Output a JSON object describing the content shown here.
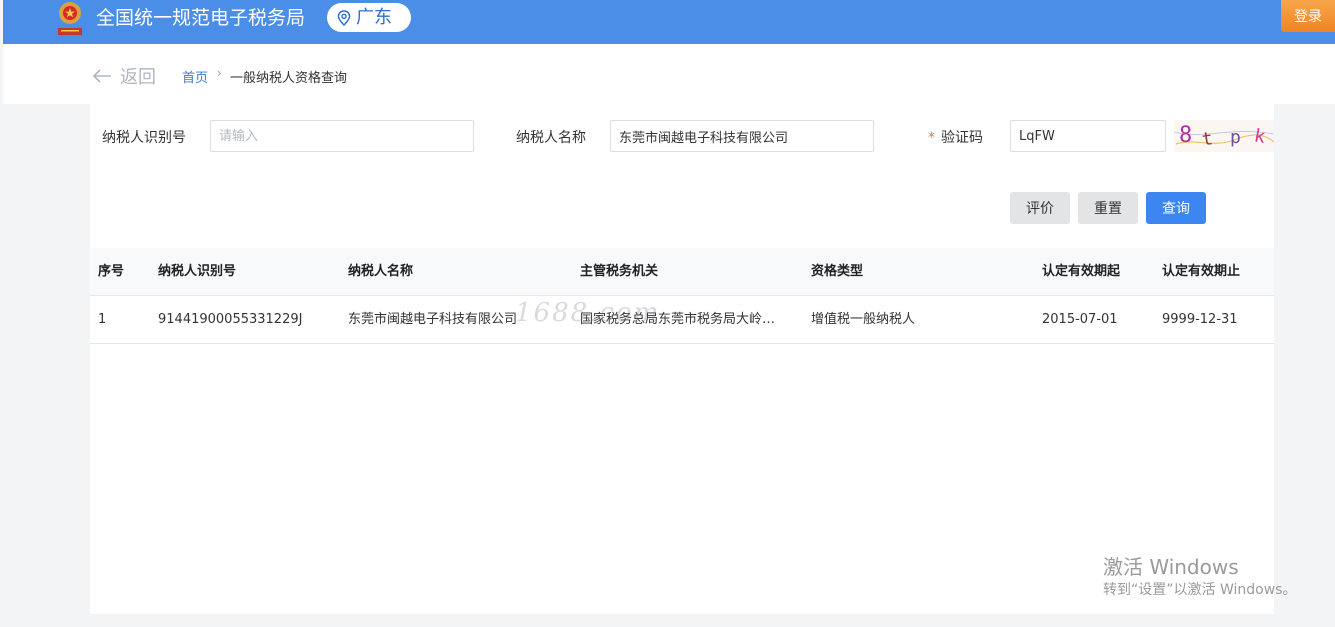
{
  "header": {
    "site_title": "全国统一规范电子税务局",
    "region": "广东",
    "login_label": "登录"
  },
  "breadcrumb": {
    "back_label": "返回",
    "home": "首页",
    "separator": "›",
    "current": "一般纳税人资格查询"
  },
  "form": {
    "taxpayer_id_label": "纳税人识别号",
    "taxpayer_id_value": "",
    "taxpayer_id_placeholder": "请输入",
    "taxpayer_name_label": "纳税人名称",
    "taxpayer_name_value": "东莞市闽越电子科技有限公司",
    "captcha_required_mark": "*",
    "captcha_label": "验证码",
    "captcha_value": "LqFW",
    "captcha_image_text": "8tpk"
  },
  "buttons": {
    "evaluate": "评价",
    "reset": "重置",
    "query": "查询"
  },
  "table": {
    "columns": [
      "序号",
      "纳税人识别号",
      "纳税人名称",
      "主管税务机关",
      "资格类型",
      "认定有效期起",
      "认定有效期止"
    ],
    "rows": [
      [
        "1",
        "91441900055331229J",
        "东莞市闽越电子科技有限公司",
        "国家税务总局东莞市税务局大岭…",
        "增值税一般纳税人",
        "2015-07-01",
        "9999-12-31"
      ]
    ]
  },
  "watermark": {
    "site": "1688.com",
    "windows_line1": "激活 Windows",
    "windows_line2": "转到“设置”以激活 Windows。"
  },
  "colors": {
    "header_bg": "#4b8ee8",
    "login_bg": "#f0902f",
    "primary": "#3d85f0",
    "link": "#3a7bd5"
  }
}
